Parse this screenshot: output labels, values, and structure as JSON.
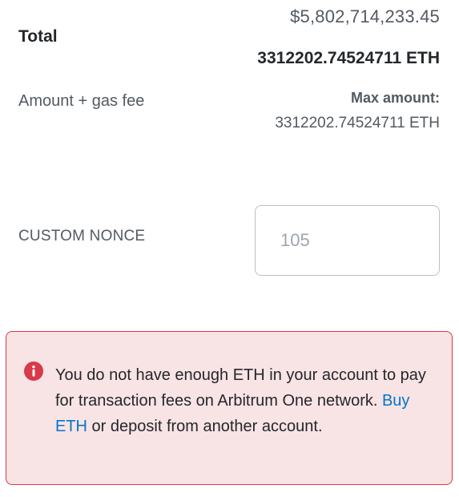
{
  "total": {
    "label": "Total",
    "usd_value": "$5,802,714,233.45",
    "eth_value": "3312202.74524711 ETH"
  },
  "amount_gas": {
    "label": "Amount + gas fee",
    "max_label": "Max amount:",
    "max_value": "3312202.74524711 ETH"
  },
  "nonce": {
    "label": "CUSTOM NONCE",
    "placeholder": "105",
    "value": ""
  },
  "error": {
    "icon": "info-circle-icon",
    "text_before": "You do not have enough ETH in your account to pay for transaction fees on Arbitrum One network. ",
    "link_label": "Buy ETH",
    "text_after": " or deposit from another account.",
    "accent_color": "#d73a49",
    "background_color": "#f8e3e5",
    "link_color": "#0376c9"
  }
}
